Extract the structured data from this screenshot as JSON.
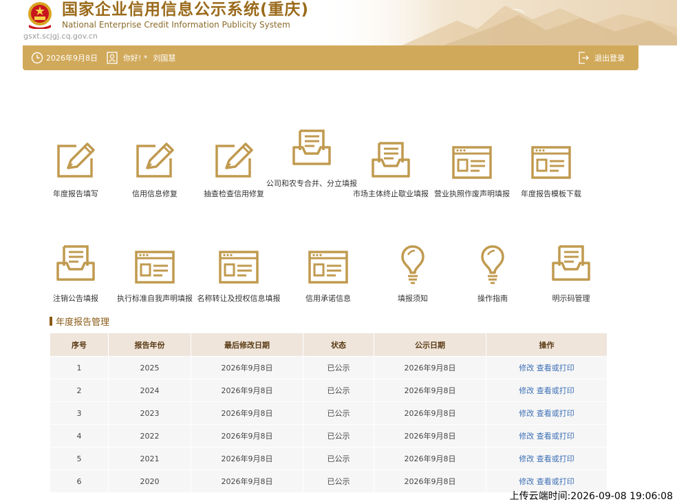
{
  "header": {
    "title_cn": "国家企业信用信息公示系统(重庆)",
    "title_en": "National Enterprise Credit Information Publicity System",
    "domain": "gsxt.scjgj.cq.gov.cn"
  },
  "topbar": {
    "date": "2026年9月8日",
    "greeting": "你好! *",
    "user": "刘国慧",
    "logout": "退出登录"
  },
  "functions_row1": [
    {
      "label": "年度报告填写",
      "icon": "pencil-edit-icon"
    },
    {
      "label": "信用信息修复",
      "icon": "pencil-edit-icon"
    },
    {
      "label": "抽查检查信用修复",
      "icon": "pencil-edit-icon"
    },
    {
      "label": "公司和农专合并、分立填报",
      "icon": "inbox-tray-icon"
    },
    {
      "label": "市场主体终止歇业填报",
      "icon": "inbox-tray-icon"
    },
    {
      "label": "营业执照作废声明填报",
      "icon": "document-card-icon"
    },
    {
      "label": "年度报告模板下载",
      "icon": "document-card-icon"
    }
  ],
  "functions_row2": [
    {
      "label": "注销公告填报",
      "icon": "inbox-tray-icon"
    },
    {
      "label": "执行标准自我声明填报",
      "icon": "document-card-icon"
    },
    {
      "label": "名称转让及授权信息填报",
      "icon": "document-card-icon"
    },
    {
      "label": "信用承诺信息",
      "icon": "document-card-icon"
    },
    {
      "label": "填报须知",
      "icon": "lightbulb-icon"
    },
    {
      "label": "操作指南",
      "icon": "lightbulb-icon"
    },
    {
      "label": "明示码管理",
      "icon": "inbox-tray-icon"
    }
  ],
  "section_title": "年度报告管理",
  "table": {
    "headers": [
      "序号",
      "报告年份",
      "最后修改日期",
      "状态",
      "公示日期",
      "操作"
    ],
    "edit_label": "修改",
    "view_label": "查看或打印",
    "rows": [
      {
        "no": "1",
        "year": "2025",
        "modified": "2026年9月8日",
        "status": "已公示",
        "published": "2026年9月8日"
      },
      {
        "no": "2",
        "year": "2024",
        "modified": "2026年9月8日",
        "status": "已公示",
        "published": "2026年9月8日"
      },
      {
        "no": "3",
        "year": "2023",
        "modified": "2026年9月8日",
        "status": "已公示",
        "published": "2026年9月8日"
      },
      {
        "no": "4",
        "year": "2022",
        "modified": "2026年9月8日",
        "status": "已公示",
        "published": "2026年9月8日"
      },
      {
        "no": "5",
        "year": "2021",
        "modified": "2026年9月8日",
        "status": "已公示",
        "published": "2026年9月8日"
      },
      {
        "no": "6",
        "year": "2020",
        "modified": "2026年9月8日",
        "status": "已公示",
        "published": "2026年9月8日"
      }
    ]
  },
  "upload_time": "上传云端时间:2026-09-08 19:06:08",
  "colors": {
    "gold": "#d1a95a",
    "brown": "#8a5a14",
    "link": "#3c6fb5"
  }
}
